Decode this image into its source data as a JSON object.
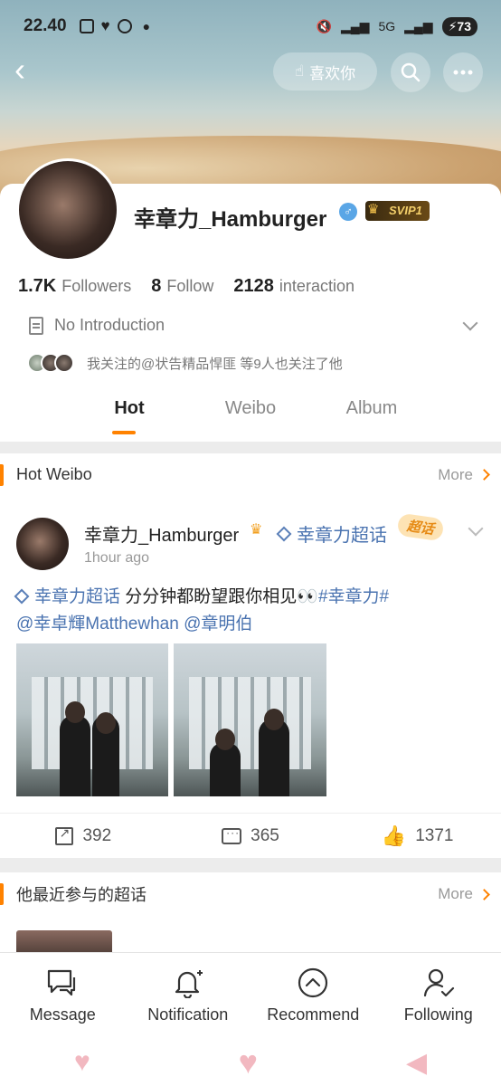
{
  "status_bar": {
    "time": "22.40",
    "network": "5G",
    "battery": "73"
  },
  "header": {
    "like_button": "喜欢你",
    "icons": [
      "back-arrow-icon",
      "search-icon",
      "more-icon"
    ]
  },
  "profile": {
    "username": "幸章力_Hamburger",
    "vip_badge": "SVIP1",
    "stats": {
      "followers_count": "1.7K",
      "followers_label": "Followers",
      "follow_count": "8",
      "follow_label": "Follow",
      "interaction_count": "2128",
      "interaction_label": "interaction"
    },
    "intro": "No Introduction",
    "mutual_text": "我关注的@状告精品悍匪 等9人也关注了他"
  },
  "tabs": [
    {
      "label": "Hot",
      "active": true
    },
    {
      "label": "Weibo",
      "active": false
    },
    {
      "label": "Album",
      "active": false
    }
  ],
  "hot_section": {
    "title": "Hot Weibo",
    "more": "More"
  },
  "post": {
    "author": "幸章力_Hamburger",
    "topic": "幸章力超话",
    "super_tag": "超话",
    "time": "1hour ago",
    "text_topic": "幸章力超话",
    "text_body": "分分钟都盼望跟你相见👀",
    "hashtag": "#幸章力#",
    "mention1": "@幸卓輝Matthewhan",
    "mention2": "@章明伯",
    "shares": "392",
    "comments": "365",
    "likes": "1371"
  },
  "recent_section": {
    "title": "他最近参与的超话",
    "more": "More"
  },
  "bottom_nav": [
    {
      "label": "Message",
      "icon": "message-icon"
    },
    {
      "label": "Notification",
      "icon": "bell-plus-icon"
    },
    {
      "label": "Recommend",
      "icon": "chevron-up-circle-icon"
    },
    {
      "label": "Following",
      "icon": "user-check-icon"
    }
  ],
  "colors": {
    "accent": "#ff8200",
    "link": "#4a73b0"
  }
}
